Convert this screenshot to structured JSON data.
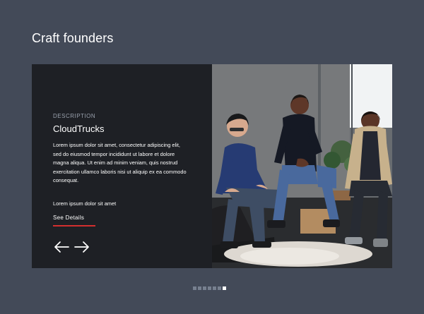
{
  "section": {
    "title": "Craft founders"
  },
  "card": {
    "eyebrow": "DESCRIPTION",
    "company": "CloudTrucks",
    "description": "Lorem ipsum dolor sit amet, consectetur adipiscing elit, sed do eiusmod tempor incididunt ut labore et dolore magna aliqua. Ut enim ad minim veniam, quis nostrud exercitation ullamco laboris nisi ut aliquip ex ea commodo consequat.",
    "summary": "Lorem ipsum dolor sit amet",
    "details_label": "See Details"
  },
  "controls": {
    "prev_icon": "arrow-left-icon",
    "next_icon": "arrow-right-icon"
  },
  "pager": {
    "total": 7,
    "active_index": 6
  },
  "colors": {
    "page_background": "#434a58",
    "panel_background": "#1e2025",
    "accent": "#d42f2f"
  }
}
